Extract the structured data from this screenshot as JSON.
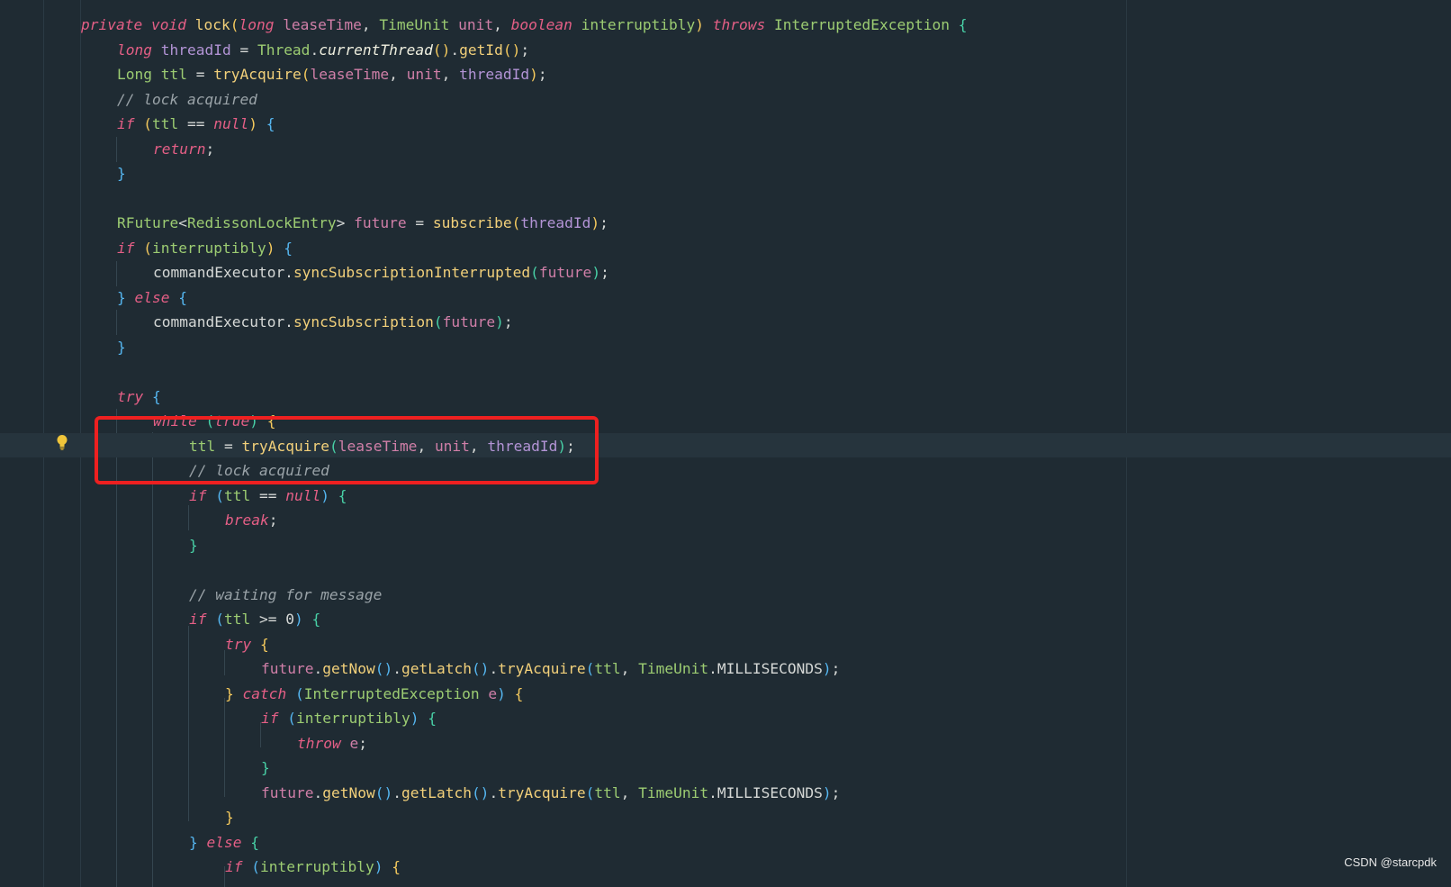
{
  "editor": {
    "watermark": "CSDN @starcpdk",
    "highlight_color": "#ee2020",
    "background_color": "#1f2b33"
  },
  "code_lines": [
    {
      "indent": 0,
      "tokens": [
        [
          "kw",
          "private"
        ],
        [
          "df",
          " "
        ],
        [
          "kw",
          "void"
        ],
        [
          "df",
          " "
        ],
        [
          "fn",
          "lock"
        ],
        [
          "br1",
          "("
        ],
        [
          "kw",
          "long"
        ],
        [
          "df",
          " "
        ],
        [
          "pm",
          "leaseTime"
        ],
        [
          "df",
          ", "
        ],
        [
          "ty",
          "TimeUnit"
        ],
        [
          "df",
          " "
        ],
        [
          "pm",
          "unit"
        ],
        [
          "df",
          ", "
        ],
        [
          "kw",
          "boolean"
        ],
        [
          "df",
          " "
        ],
        [
          "ty",
          "interruptibly"
        ],
        [
          "br1",
          ")"
        ],
        [
          "df",
          " "
        ],
        [
          "kw",
          "throws"
        ],
        [
          "df",
          " "
        ],
        [
          "ty",
          "InterruptedException"
        ],
        [
          "df",
          " "
        ],
        [
          "br3",
          "{"
        ]
      ]
    },
    {
      "indent": 1,
      "tokens": [
        [
          "kw",
          "long"
        ],
        [
          "df",
          " "
        ],
        [
          "pl",
          "threadId"
        ],
        [
          "df",
          " = "
        ],
        [
          "ty",
          "Thread"
        ],
        [
          "df",
          "."
        ],
        [
          "it",
          "currentThread"
        ],
        [
          "br1",
          "()"
        ],
        [
          "df",
          "."
        ],
        [
          "fn",
          "getId"
        ],
        [
          "br1",
          "()"
        ],
        [
          "df",
          ";"
        ]
      ]
    },
    {
      "indent": 1,
      "tokens": [
        [
          "ty",
          "Long"
        ],
        [
          "df",
          " "
        ],
        [
          "ty",
          "ttl"
        ],
        [
          "df",
          " = "
        ],
        [
          "fn",
          "tryAcquire"
        ],
        [
          "br1",
          "("
        ],
        [
          "pm",
          "leaseTime"
        ],
        [
          "df",
          ", "
        ],
        [
          "pm",
          "unit"
        ],
        [
          "df",
          ", "
        ],
        [
          "pl",
          "threadId"
        ],
        [
          "br1",
          ")"
        ],
        [
          "df",
          ";"
        ]
      ]
    },
    {
      "indent": 1,
      "tokens": [
        [
          "cm",
          "// lock acquired"
        ]
      ]
    },
    {
      "indent": 1,
      "tokens": [
        [
          "kw",
          "if"
        ],
        [
          "df",
          " "
        ],
        [
          "br1",
          "("
        ],
        [
          "ty",
          "ttl"
        ],
        [
          "df",
          " == "
        ],
        [
          "kw",
          "null"
        ],
        [
          "br1",
          ")"
        ],
        [
          "df",
          " "
        ],
        [
          "br2",
          "{"
        ]
      ]
    },
    {
      "indent": 2,
      "tokens": [
        [
          "kw",
          "return"
        ],
        [
          "df",
          ";"
        ]
      ]
    },
    {
      "indent": 1,
      "tokens": [
        [
          "br2",
          "}"
        ]
      ]
    },
    {
      "indent": 0,
      "tokens": []
    },
    {
      "indent": 1,
      "tokens": [
        [
          "ty",
          "RFuture"
        ],
        [
          "df",
          "<"
        ],
        [
          "ty",
          "RedissonLockEntry"
        ],
        [
          "df",
          "> "
        ],
        [
          "pm",
          "future"
        ],
        [
          "df",
          " = "
        ],
        [
          "fn",
          "subscribe"
        ],
        [
          "br1",
          "("
        ],
        [
          "pl",
          "threadId"
        ],
        [
          "br1",
          ")"
        ],
        [
          "df",
          ";"
        ]
      ]
    },
    {
      "indent": 1,
      "tokens": [
        [
          "kw",
          "if"
        ],
        [
          "df",
          " "
        ],
        [
          "br1",
          "("
        ],
        [
          "ty",
          "interruptibly"
        ],
        [
          "br1",
          ")"
        ],
        [
          "df",
          " "
        ],
        [
          "br2",
          "{"
        ]
      ]
    },
    {
      "indent": 2,
      "tokens": [
        [
          "df",
          "commandExecutor."
        ],
        [
          "fn",
          "syncSubscriptionInterrupted"
        ],
        [
          "br3",
          "("
        ],
        [
          "pm",
          "future"
        ],
        [
          "br3",
          ")"
        ],
        [
          "df",
          ";"
        ]
      ]
    },
    {
      "indent": 1,
      "tokens": [
        [
          "br2",
          "}"
        ],
        [
          "df",
          " "
        ],
        [
          "kw",
          "else"
        ],
        [
          "df",
          " "
        ],
        [
          "br2",
          "{"
        ]
      ]
    },
    {
      "indent": 2,
      "tokens": [
        [
          "df",
          "commandExecutor."
        ],
        [
          "fn",
          "syncSubscription"
        ],
        [
          "br3",
          "("
        ],
        [
          "pm",
          "future"
        ],
        [
          "br3",
          ")"
        ],
        [
          "df",
          ";"
        ]
      ]
    },
    {
      "indent": 1,
      "tokens": [
        [
          "br2",
          "}"
        ]
      ]
    },
    {
      "indent": 0,
      "tokens": []
    },
    {
      "indent": 1,
      "tokens": [
        [
          "kw",
          "try"
        ],
        [
          "df",
          " "
        ],
        [
          "br2",
          "{"
        ]
      ]
    },
    {
      "indent": 2,
      "tokens": [
        [
          "kw",
          "while"
        ],
        [
          "df",
          " "
        ],
        [
          "br3",
          "("
        ],
        [
          "kw",
          "true"
        ],
        [
          "br3",
          ")"
        ],
        [
          "df",
          " "
        ],
        [
          "br1",
          "{"
        ]
      ]
    },
    {
      "indent": 3,
      "tokens": [
        [
          "ty",
          "ttl"
        ],
        [
          "df",
          " = "
        ],
        [
          "fn",
          "tryAcquire"
        ],
        [
          "br3",
          "("
        ],
        [
          "pm",
          "leaseTime"
        ],
        [
          "df",
          ", "
        ],
        [
          "pm",
          "unit"
        ],
        [
          "df",
          ", "
        ],
        [
          "pl",
          "threadId"
        ],
        [
          "br3",
          ")"
        ],
        [
          "df",
          ";"
        ]
      ]
    },
    {
      "indent": 3,
      "tokens": [
        [
          "cm",
          "// lock acquired"
        ]
      ]
    },
    {
      "indent": 3,
      "tokens": [
        [
          "kw",
          "if"
        ],
        [
          "df",
          " "
        ],
        [
          "br2",
          "("
        ],
        [
          "ty",
          "ttl"
        ],
        [
          "df",
          " == "
        ],
        [
          "kw",
          "null"
        ],
        [
          "br2",
          ")"
        ],
        [
          "df",
          " "
        ],
        [
          "br3",
          "{"
        ]
      ]
    },
    {
      "indent": 4,
      "tokens": [
        [
          "kw",
          "break"
        ],
        [
          "df",
          ";"
        ]
      ]
    },
    {
      "indent": 3,
      "tokens": [
        [
          "br3",
          "}"
        ]
      ]
    },
    {
      "indent": 0,
      "tokens": []
    },
    {
      "indent": 3,
      "tokens": [
        [
          "cm",
          "// waiting for message"
        ]
      ]
    },
    {
      "indent": 3,
      "tokens": [
        [
          "kw",
          "if"
        ],
        [
          "df",
          " "
        ],
        [
          "br2",
          "("
        ],
        [
          "ty",
          "ttl"
        ],
        [
          "df",
          " >= "
        ],
        [
          "nu",
          "0"
        ],
        [
          "br2",
          ")"
        ],
        [
          "df",
          " "
        ],
        [
          "br3",
          "{"
        ]
      ]
    },
    {
      "indent": 4,
      "tokens": [
        [
          "kw",
          "try"
        ],
        [
          "df",
          " "
        ],
        [
          "br1",
          "{"
        ]
      ]
    },
    {
      "indent": 5,
      "tokens": [
        [
          "pm",
          "future"
        ],
        [
          "df",
          "."
        ],
        [
          "fn",
          "getNow"
        ],
        [
          "br2",
          "()"
        ],
        [
          "df",
          "."
        ],
        [
          "fn",
          "getLatch"
        ],
        [
          "br2",
          "()"
        ],
        [
          "df",
          "."
        ],
        [
          "fn",
          "tryAcquire"
        ],
        [
          "br2",
          "("
        ],
        [
          "ty",
          "ttl"
        ],
        [
          "df",
          ", "
        ],
        [
          "ty",
          "TimeUnit"
        ],
        [
          "df",
          ".MILLISECONDS"
        ],
        [
          "br2",
          ")"
        ],
        [
          "df",
          ";"
        ]
      ]
    },
    {
      "indent": 4,
      "tokens": [
        [
          "br1",
          "}"
        ],
        [
          "df",
          " "
        ],
        [
          "kw",
          "catch"
        ],
        [
          "df",
          " "
        ],
        [
          "br2",
          "("
        ],
        [
          "ty",
          "InterruptedException"
        ],
        [
          "df",
          " "
        ],
        [
          "pm",
          "e"
        ],
        [
          "br2",
          ")"
        ],
        [
          "df",
          " "
        ],
        [
          "br1",
          "{"
        ]
      ]
    },
    {
      "indent": 5,
      "tokens": [
        [
          "kw",
          "if"
        ],
        [
          "df",
          " "
        ],
        [
          "br2",
          "("
        ],
        [
          "ty",
          "interruptibly"
        ],
        [
          "br2",
          ")"
        ],
        [
          "df",
          " "
        ],
        [
          "br3",
          "{"
        ]
      ]
    },
    {
      "indent": 6,
      "tokens": [
        [
          "kw",
          "throw"
        ],
        [
          "df",
          " "
        ],
        [
          "pm",
          "e"
        ],
        [
          "df",
          ";"
        ]
      ]
    },
    {
      "indent": 5,
      "tokens": [
        [
          "br3",
          "}"
        ]
      ]
    },
    {
      "indent": 5,
      "tokens": [
        [
          "pm",
          "future"
        ],
        [
          "df",
          "."
        ],
        [
          "fn",
          "getNow"
        ],
        [
          "br2",
          "()"
        ],
        [
          "df",
          "."
        ],
        [
          "fn",
          "getLatch"
        ],
        [
          "br2",
          "()"
        ],
        [
          "df",
          "."
        ],
        [
          "fn",
          "tryAcquire"
        ],
        [
          "br2",
          "("
        ],
        [
          "ty",
          "ttl"
        ],
        [
          "df",
          ", "
        ],
        [
          "ty",
          "TimeUnit"
        ],
        [
          "df",
          ".MILLISECONDS"
        ],
        [
          "br2",
          ")"
        ],
        [
          "df",
          ";"
        ]
      ]
    },
    {
      "indent": 4,
      "tokens": [
        [
          "br1",
          "}"
        ]
      ]
    },
    {
      "indent": 3,
      "tokens": [
        [
          "br2",
          "}"
        ],
        [
          "df",
          " "
        ],
        [
          "kw",
          "else"
        ],
        [
          "df",
          " "
        ],
        [
          "br3",
          "{"
        ]
      ]
    },
    {
      "indent": 4,
      "tokens": [
        [
          "kw",
          "if"
        ],
        [
          "df",
          " "
        ],
        [
          "br2",
          "("
        ],
        [
          "ty",
          "interruptibly"
        ],
        [
          "br2",
          ")"
        ],
        [
          "df",
          " "
        ],
        [
          "br1",
          "{"
        ]
      ]
    }
  ]
}
